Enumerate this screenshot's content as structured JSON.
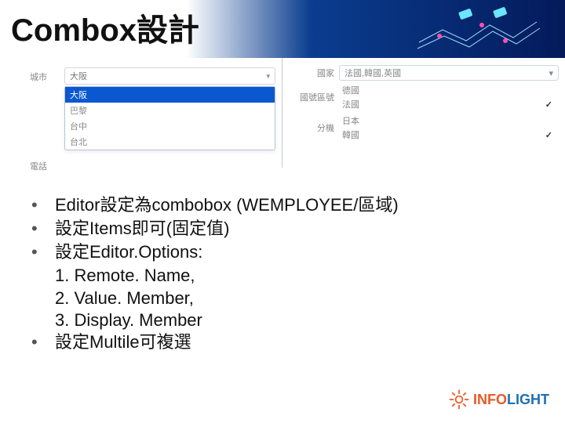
{
  "title": "Combox設計",
  "left_screenshot": {
    "city_label": "城市",
    "city_value": "大阪",
    "phone_label": "電話",
    "options": [
      "大阪",
      "巴黎",
      "台中",
      "台北"
    ],
    "selected_option": "大阪"
  },
  "right_screenshot": {
    "country_label": "國家",
    "country_value": "法國,韓國,英國",
    "dialcode_label": "國號區號",
    "ext_label": "分機",
    "check_items": [
      {
        "label": "德國",
        "checked": false
      },
      {
        "label": "法國",
        "checked": true
      },
      {
        "label": "日本",
        "checked": false
      },
      {
        "label": "韓國",
        "checked": true
      }
    ]
  },
  "bullets": [
    "Editor設定為combobox (WEMPLOYEE/區域)",
    "設定Items即可(固定值)",
    "設定Editor.Options:"
  ],
  "sublines": [
    "1. Remote. Name,",
    "2. Value. Member,",
    "3. Display. Member"
  ],
  "bullet_last": "設定Multile可複選",
  "logo": {
    "brand1": "INFO",
    "brand2": "LIGHT"
  }
}
